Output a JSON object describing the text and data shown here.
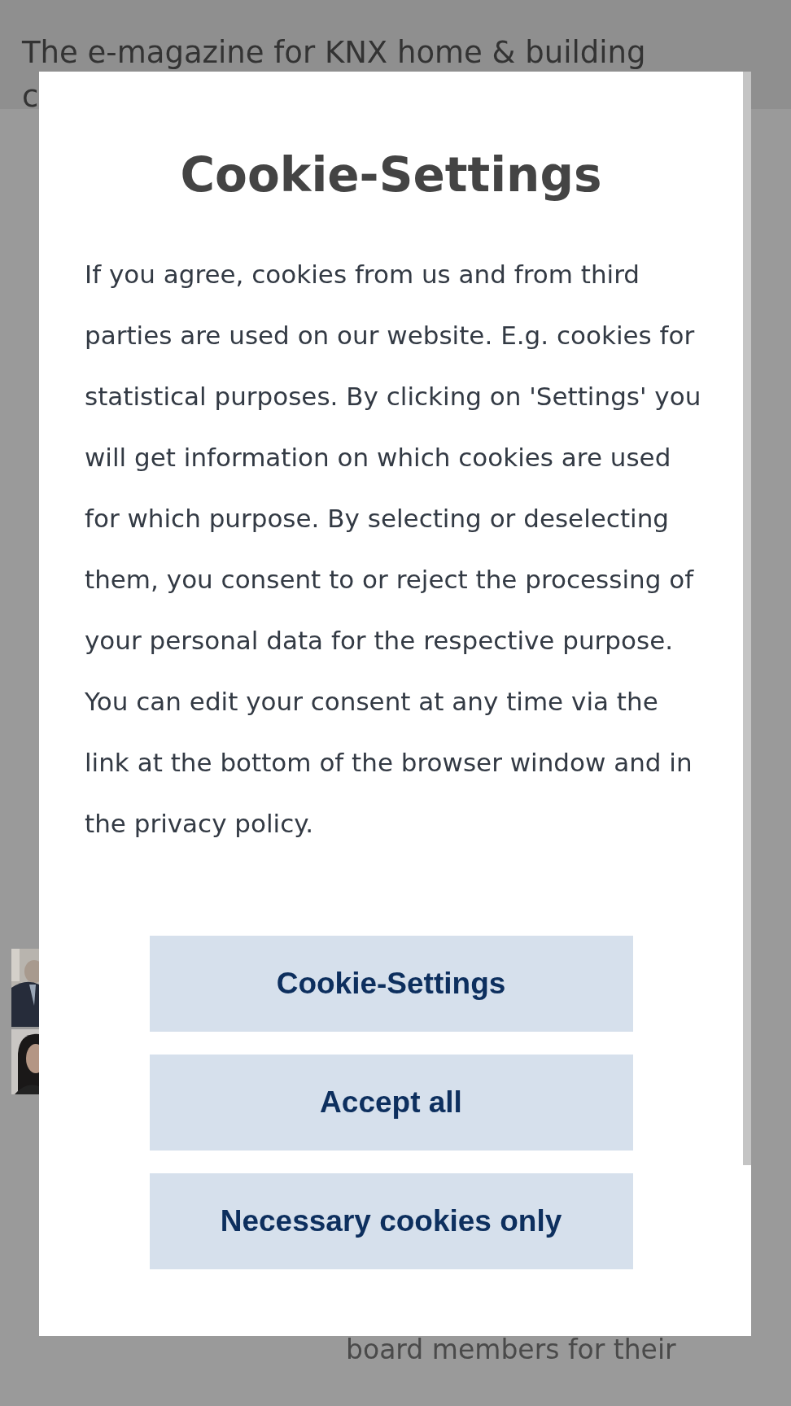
{
  "page": {
    "tagline_lines": [
      "The e-magazine for KNX home & building",
      "c"
    ],
    "photos": [
      {
        "kind": "picture"
      },
      {
        "kind": "picture"
      }
    ],
    "article_lines": [
      "board members for their"
    ]
  },
  "dialog": {
    "title": "Cookie-Settings",
    "body": "If you agree, cookies from us and from third parties are used on our website. E.g. cookies for statistical purposes. By clicking on 'Settings' you will get information on which cookies are used for which purpose. By selecting or deselecting them, you consent to or reject the processing of your personal data for the respective purpose. You can edit your consent at any time via the link at the bottom of the browser window and in the privacy policy.",
    "buttons": [
      "Cookie-Settings",
      "Accept all",
      "Necessary cookies only"
    ]
  }
}
